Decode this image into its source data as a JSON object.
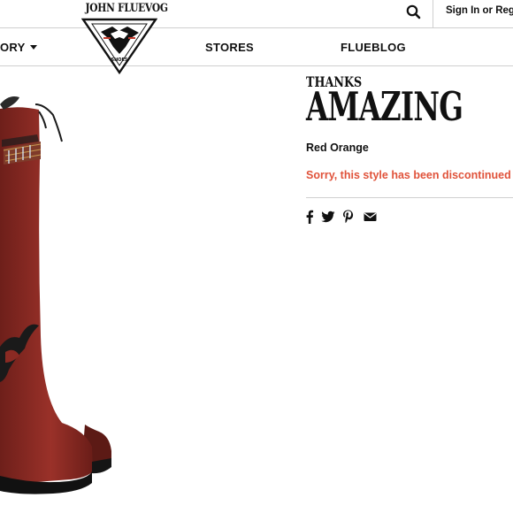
{
  "header": {
    "sign_in_label": "Sign In or Regis",
    "search_icon": "search-icon"
  },
  "logo": {
    "wordmark": "JOHN FLUEVOG",
    "sub_text": "SHOES"
  },
  "nav": {
    "items": [
      {
        "label": "TORY"
      },
      {
        "label": "STORES"
      },
      {
        "label": "FLUEBLOG"
      }
    ]
  },
  "product": {
    "name_prefix": "THANKS",
    "name": "AMAZING",
    "color": "Red Orange",
    "status": "Sorry, this style has been discontinued",
    "share_icons": [
      "facebook-icon",
      "twitter-icon",
      "pinterest-icon",
      "email-icon"
    ]
  },
  "colors": {
    "accent": "#e0533b",
    "boot": "#8b2a23",
    "divider": "#cfcfcf"
  }
}
